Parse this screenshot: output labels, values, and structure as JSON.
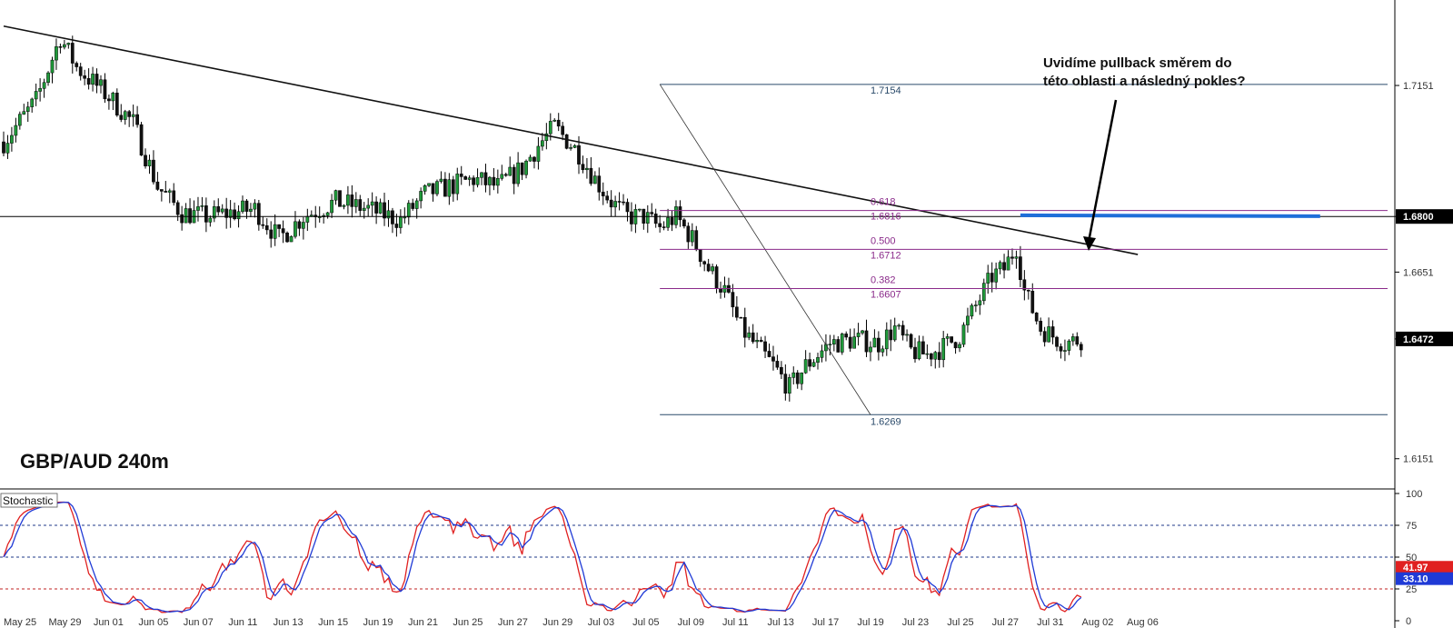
{
  "chart_data": {
    "type": "candlestick",
    "title": "GBP/AUD 240m",
    "price_axis": {
      "range": [
        1.607,
        1.738
      ],
      "ticks": [
        1.6151,
        1.6472,
        1.6651,
        1.68,
        1.7151
      ],
      "tick_labels": [
        "1.6151",
        "1.6472",
        "1.6651",
        "1.6800",
        "1.7151"
      ]
    },
    "date_labels": [
      "May 25",
      "May 29",
      "Jun 01",
      "Jun 05",
      "Jun 07",
      "Jun 11",
      "Jun 13",
      "Jun 15",
      "Jun 19",
      "Jun 21",
      "Jun 25",
      "Jun 27",
      "Jun 29",
      "Jul 03",
      "Jul 05",
      "Jul 09",
      "Jul 11",
      "Jul 13",
      "Jul 17",
      "Jul 19",
      "Jul 23",
      "Jul 25",
      "Jul 27",
      "Jul 31",
      "Aug 02",
      "Aug 06"
    ],
    "price_path": [
      [
        0,
        1.7
      ],
      [
        8,
        1.711
      ],
      [
        14,
        1.728
      ],
      [
        18,
        1.72
      ],
      [
        26,
        1.712
      ],
      [
        32,
        1.705
      ],
      [
        38,
        1.688
      ],
      [
        44,
        1.681
      ],
      [
        50,
        1.68
      ],
      [
        56,
        1.681
      ],
      [
        62,
        1.682
      ],
      [
        68,
        1.674
      ],
      [
        74,
        1.68
      ],
      [
        82,
        1.684
      ],
      [
        90,
        1.682
      ],
      [
        98,
        1.679
      ],
      [
        104,
        1.686
      ],
      [
        110,
        1.688
      ],
      [
        116,
        1.69
      ],
      [
        122,
        1.688
      ],
      [
        128,
        1.693
      ],
      [
        132,
        1.699
      ],
      [
        136,
        1.704
      ],
      [
        142,
        1.697
      ],
      [
        146,
        1.69
      ],
      [
        150,
        1.684
      ],
      [
        154,
        1.68
      ],
      [
        158,
        1.68
      ],
      [
        162,
        1.677
      ],
      [
        166,
        1.68
      ],
      [
        170,
        1.674
      ],
      [
        174,
        1.666
      ],
      [
        178,
        1.66
      ],
      [
        182,
        1.65
      ],
      [
        186,
        1.645
      ],
      [
        190,
        1.64
      ],
      [
        194,
        1.634
      ],
      [
        198,
        1.64
      ],
      [
        204,
        1.646
      ],
      [
        210,
        1.647
      ],
      [
        216,
        1.646
      ],
      [
        220,
        1.65
      ],
      [
        224,
        1.644
      ],
      [
        228,
        1.643
      ],
      [
        232,
        1.645
      ],
      [
        236,
        1.648
      ],
      [
        240,
        1.656
      ],
      [
        244,
        1.664
      ],
      [
        247,
        1.666
      ],
      [
        250,
        1.672
      ],
      [
        252,
        1.66
      ],
      [
        256,
        1.65
      ],
      [
        262,
        1.646
      ],
      [
        266,
        1.6472
      ]
    ],
    "horizontal_lines": [
      {
        "value": 1.68,
        "label": "1.6800",
        "color": "#000000"
      }
    ],
    "trendline": {
      "from": [
        0,
        1.731
      ],
      "to": [
        280,
        1.6698
      ],
      "color": "#111111"
    },
    "fibonacci": {
      "high": 1.7154,
      "low": 1.6269,
      "levels": [
        {
          "ratio": "0.618",
          "price": "1.6816",
          "value": 1.6816,
          "color": "#8a2a8a"
        },
        {
          "ratio": "0.500",
          "price": "1.6712",
          "value": 1.6712,
          "color": "#8a2a8a"
        },
        {
          "ratio": "0.382",
          "price": "1.6607",
          "value": 1.6607,
          "color": "#8a2a8a"
        }
      ],
      "high_label": "1.7154",
      "low_label": "1.6269",
      "line_color": "#2a4a6a"
    },
    "target_zone": {
      "value": 1.6802,
      "color": "#1e6fd9"
    },
    "current_price": {
      "value": 1.6472,
      "label": "1.6472"
    },
    "annotation": {
      "lines": [
        "Uvidíme pullback směrem do",
        "této oblasti a následný pokles?"
      ]
    },
    "stochastic": {
      "label": "Stochastic",
      "range": [
        0,
        100
      ],
      "ticks": [
        0,
        25,
        50,
        75,
        100
      ],
      "tick_labels": [
        "0",
        "25",
        "50",
        "75",
        "100"
      ],
      "levels": [
        75,
        50,
        25
      ],
      "k_value": 41.97,
      "d_value": 33.1,
      "k_label": "41.97",
      "d_label": "33.10",
      "k_color": "#e02020",
      "d_color": "#1f3ad6"
    }
  }
}
